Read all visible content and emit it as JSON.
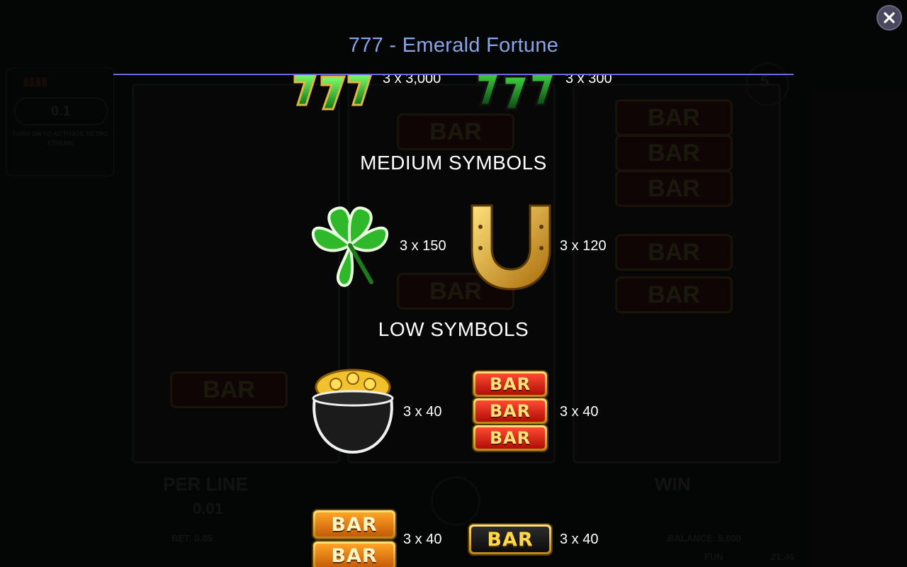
{
  "window": {
    "title": "777 - Emerald Fortune",
    "close_icon": "close-icon"
  },
  "background": {
    "panel_value": "0.1",
    "panel_note": "TURN ON TO ACTIVATE RETRO XTREME",
    "per_line_label": "PER LINE",
    "per_line_value": "0.01",
    "win_label": "WIN",
    "bet_text": "BET: 0.05",
    "balance_text": "BALANCE: 5,000",
    "mode_text": "FUN",
    "clock_text": "21:46",
    "bar_text": "BAR",
    "badge_text": "5"
  },
  "paytable": {
    "high_symbols": [
      {
        "icon": "gold-sevens-icon",
        "payout": "3 x 3,000"
      },
      {
        "icon": "green-sevens-icon",
        "payout": "3 x 300"
      }
    ],
    "medium_title": "MEDIUM SYMBOLS",
    "medium_symbols": [
      {
        "icon": "clover-icon",
        "payout": "3 x 150"
      },
      {
        "icon": "horseshoe-icon",
        "payout": "3 x 120"
      }
    ],
    "low_title": "LOW SYMBOLS",
    "low_symbols": [
      {
        "icon": "pot-of-gold-icon",
        "payout": "3 x 40"
      },
      {
        "icon": "triple-bar-icon",
        "payout": "3 x 40"
      },
      {
        "icon": "double-bar-icon",
        "payout": "3 x 40"
      },
      {
        "icon": "single-bar-icon",
        "payout": "3 x 40"
      }
    ],
    "bar_label": "BAR"
  },
  "colors": {
    "title": "#8aa4e8",
    "rule": "#6a6ad8",
    "overlay": "#000000"
  }
}
